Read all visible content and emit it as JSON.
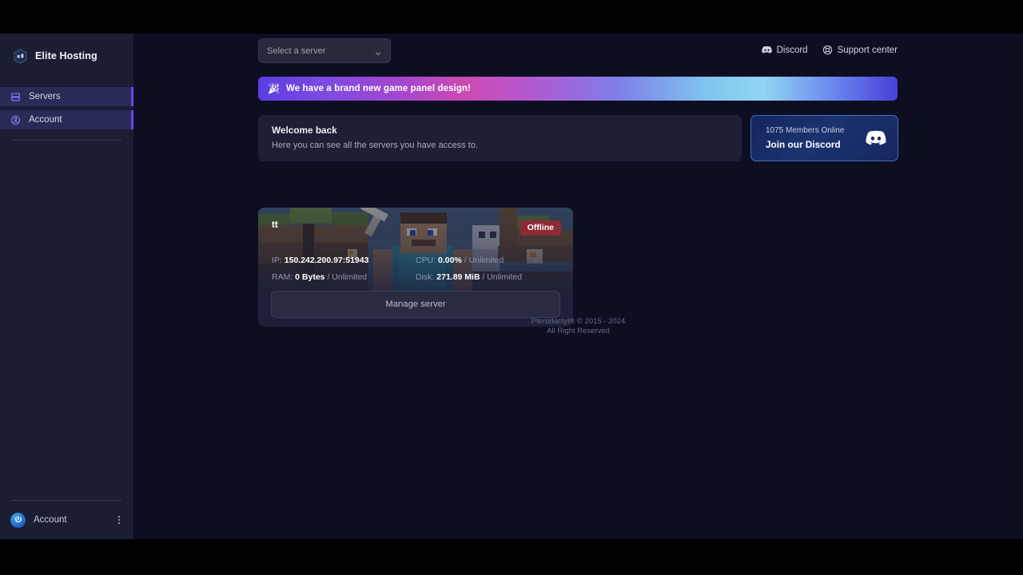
{
  "sidebar": {
    "brand": {
      "name": "Elite Hosting",
      "logo_icon": "shield-hex-logo-icon"
    },
    "items": [
      {
        "label": "Servers",
        "icon": "server-rack-icon",
        "active": true
      },
      {
        "label": "Account",
        "icon": "user-circle-icon",
        "active": true
      }
    ],
    "account": {
      "label": "Account",
      "avatar_icon": "user-avatar-icon",
      "menu_icon": "kebab-menu-icon"
    }
  },
  "header": {
    "server_select": {
      "value": "Select a server",
      "placeholder": "Select a server",
      "chevron_icon": "chevron-down-icon"
    },
    "links": [
      {
        "label": "Discord",
        "icon": "discord-icon"
      },
      {
        "label": "Support center",
        "icon": "lifebuoy-icon"
      }
    ]
  },
  "banner": {
    "icon": "party-popper-icon",
    "text": "We have a brand new game panel design!"
  },
  "welcome": {
    "title": "Welcome back",
    "subtitle": "Here you can see all the servers you have access to."
  },
  "discord_card": {
    "members_online": "1075 Members Online",
    "cta": "Join our Discord",
    "logo_icon": "discord-logo-icon"
  },
  "server": {
    "name": "tt",
    "status": "Offline",
    "status_color": "#8c2b33",
    "background_icon": "minecraft-steve-banner",
    "stats": [
      {
        "key": "IP:",
        "value": "150.242.200.97:51943",
        "limit": ""
      },
      {
        "key": "CPU:",
        "value": "0.00%",
        "limit": " / Unlimited"
      },
      {
        "key": "RAM:",
        "value": "0 Bytes",
        "limit": " / Unlimited"
      },
      {
        "key": "Disk:",
        "value": "271.89 MiB",
        "limit": " / Unlimited"
      }
    ],
    "manage_label": "Manage server"
  },
  "footer": {
    "line1": "Pterodactyl® © 2015 - 2024",
    "line2": "All Right Reserved"
  },
  "colors": {
    "page_bg": "#0d0e21",
    "sidebar_bg": "#1b1d33",
    "nav_active_bg": "#2a2a57",
    "nav_active_accent": "#5b4fe4",
    "card_bg": "#1c1f36",
    "discord_blue": "#1b3370",
    "offline_red": "#8c2b33"
  }
}
